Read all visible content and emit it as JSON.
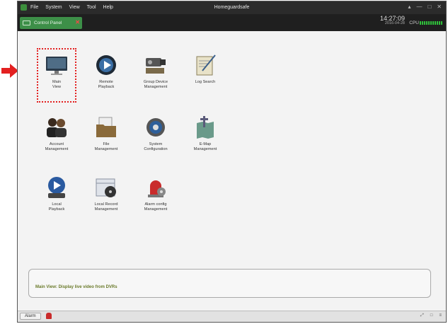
{
  "window": {
    "title": "Homeguardsafe",
    "menu": [
      "File",
      "System",
      "View",
      "Tool",
      "Help"
    ],
    "controls": [
      "&#x25B4;",
      "—",
      "□",
      "✕"
    ]
  },
  "tab": {
    "label": "Control Panel",
    "close": "✕"
  },
  "clock": {
    "time": "14:27:09",
    "date": "2016-04-28"
  },
  "cpu": {
    "label": "CPU"
  },
  "items": [
    {
      "label": "Main\nView",
      "icon": "monitor-icon"
    },
    {
      "label": "Remote\nPlayback",
      "icon": "remote-playback-icon"
    },
    {
      "label": "Group Device\nManagement",
      "icon": "group-device-icon"
    },
    {
      "label": "Log Search",
      "icon": "log-search-icon"
    },
    {
      "label": "Account\nManagement",
      "icon": "account-icon"
    },
    {
      "label": "File\nManagement",
      "icon": "file-folder-icon"
    },
    {
      "label": "System\nConfiguration",
      "icon": "system-config-icon"
    },
    {
      "label": "E-Map\nManagement",
      "icon": "emap-icon"
    },
    {
      "label": "Local\nPlayback",
      "icon": "local-playback-icon"
    },
    {
      "label": "Local Record\nManagement",
      "icon": "local-record-icon"
    },
    {
      "label": "Alarm config\nManagement",
      "icon": "alarm-config-icon"
    }
  ],
  "info": {
    "text": "Main View: Display live video from DVRs"
  },
  "statusbar": {
    "alarm": "Alarm",
    "right": [
      "⤢",
      "□",
      "≡"
    ]
  },
  "colors": {
    "accent": "#3d8f48",
    "highlight": "#e32020"
  }
}
